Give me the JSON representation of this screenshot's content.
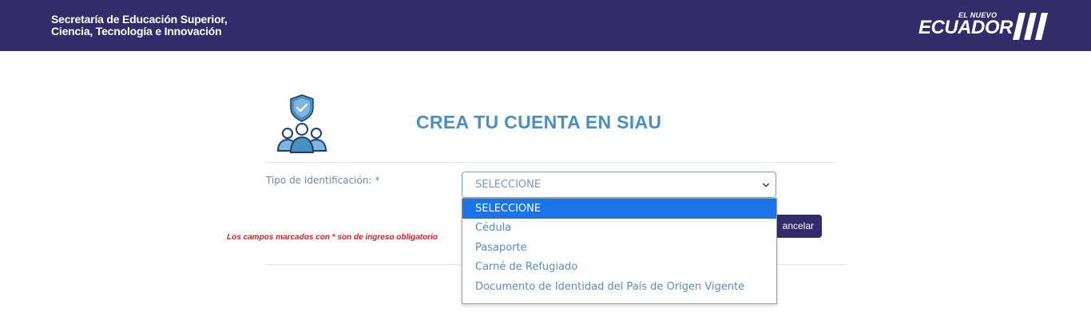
{
  "header": {
    "org_line1": "Secretaría de Educación Superior,",
    "org_line2": "Ciencia, Tecnología e Innovación",
    "brand_small": "EL NUEVO",
    "brand_main": "ECUADOR"
  },
  "page": {
    "title": "CREA TU CUENTA EN SIAU",
    "logo_icon": "users-shield-icon"
  },
  "form": {
    "id_type_label": "Tipo de Identificación: *",
    "id_type_selected": "SELECCIONE",
    "id_type_options": [
      "SELECCIONE",
      "Cédula",
      "Pasaporte",
      "Carné de Refugiado",
      "Documento de Identidad del País de Origen Vigente"
    ],
    "cancel_label": "ancelar",
    "required_note": "Los campos marcados con * son de ingreso obligatorio"
  },
  "colors": {
    "header_bg": "#332c6b",
    "title_color": "#4a8fc1",
    "highlight": "#1a73e8",
    "warning": "#e51b2b"
  }
}
